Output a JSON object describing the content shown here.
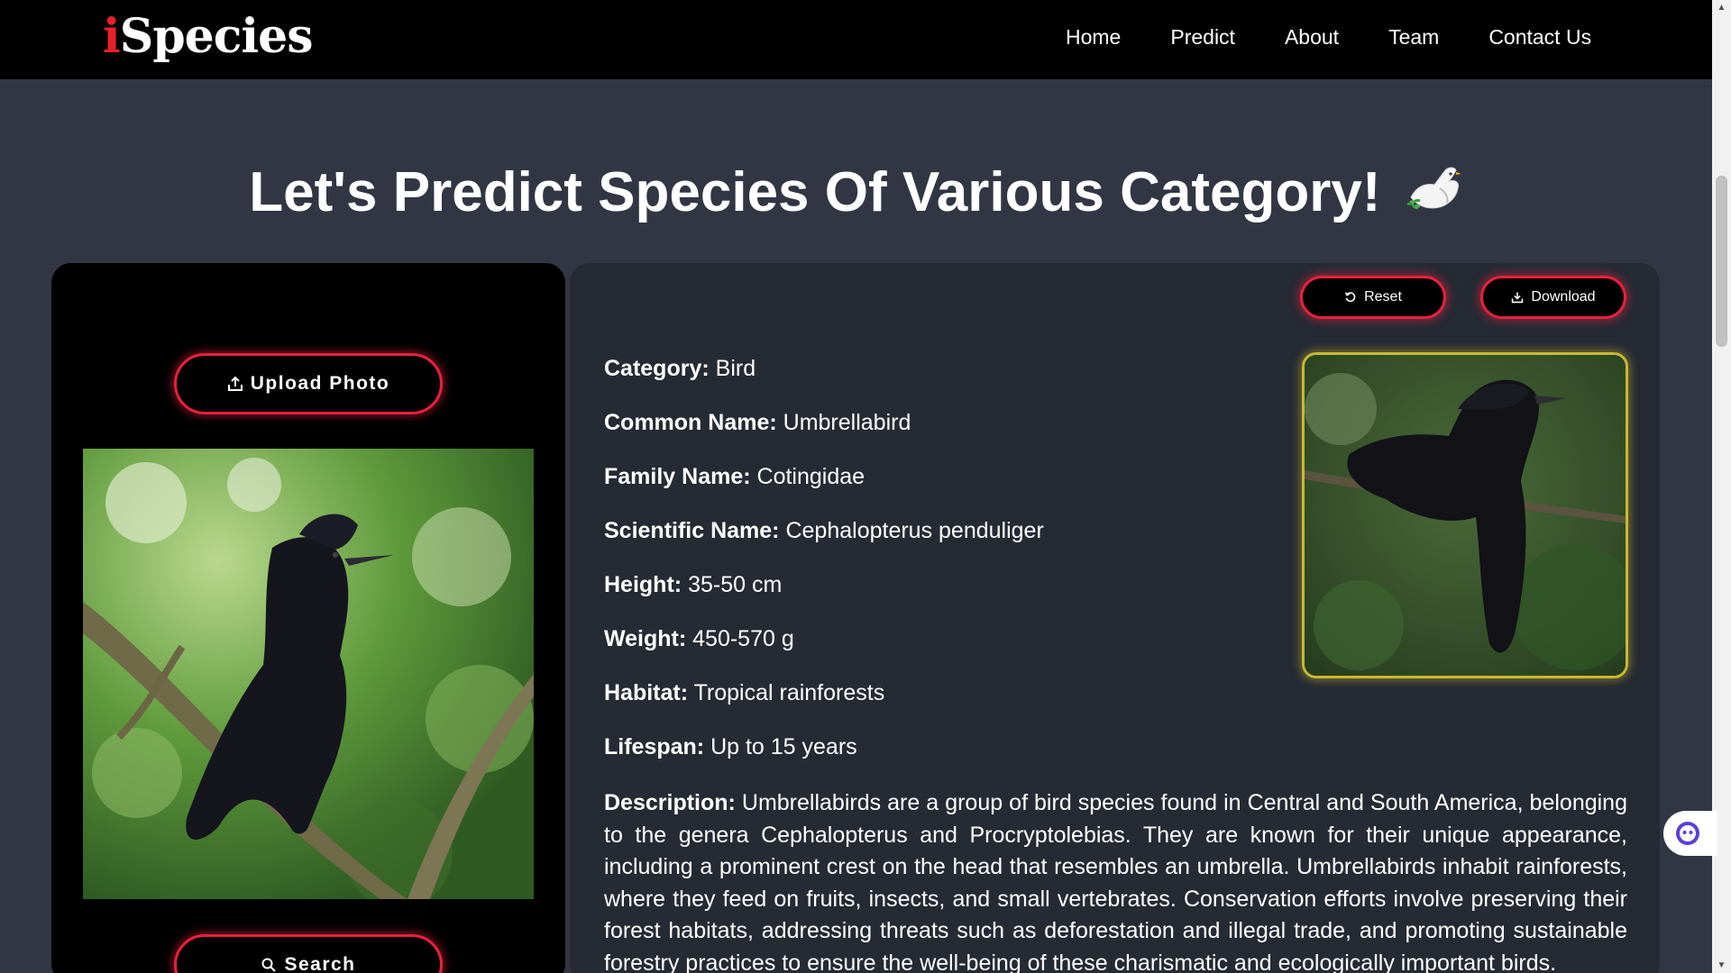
{
  "navbar": {
    "logo_first": "i",
    "logo_rest": "Species",
    "links": [
      "Home",
      "Predict",
      "About",
      "Team",
      "Contact Us"
    ]
  },
  "heading": {
    "title": "Let's Predict Species Of Various Category!",
    "icon": "dove-icon"
  },
  "upload": {
    "button_label": "Upload Photo",
    "search_label": "Search"
  },
  "actions": {
    "reset_label": "Reset",
    "download_label": "Download"
  },
  "result": {
    "fields": [
      {
        "label": "Category:",
        "value": "Bird"
      },
      {
        "label": "Common Name:",
        "value": "Umbrellabird"
      },
      {
        "label": "Family Name:",
        "value": "Cotingidae"
      },
      {
        "label": "Scientific Name:",
        "value": "Cephalopterus penduliger"
      },
      {
        "label": "Height:",
        "value": "35-50 cm"
      },
      {
        "label": "Weight:",
        "value": "450-570 g"
      },
      {
        "label": "Habitat:",
        "value": "Tropical rainforests"
      },
      {
        "label": "Lifespan:",
        "value": "Up to 15 years"
      }
    ],
    "description_label": "Description:",
    "description": "Umbrellabirds are a group of bird species found in Central and South America, belonging to the genera Cephalopterus and Procryptolebias. They are known for their unique appearance, including a prominent crest on the head that resembles an umbrella. Umbrellabirds inhabit rainforests, where they feed on fruits, insects, and small vertebrates. Conservation efforts involve preserving their forest habitats, addressing threats such as deforestation and illegal trade, and promoting sustainable forestry practices to ensure the well-being of these charismatic and ecologically important birds."
  },
  "colors": {
    "accent_red": "#e8203e",
    "photo_border": "#c9b930",
    "page_bg": "#323643",
    "panel_dark": "#000000",
    "panel_slate": "#262a33"
  }
}
